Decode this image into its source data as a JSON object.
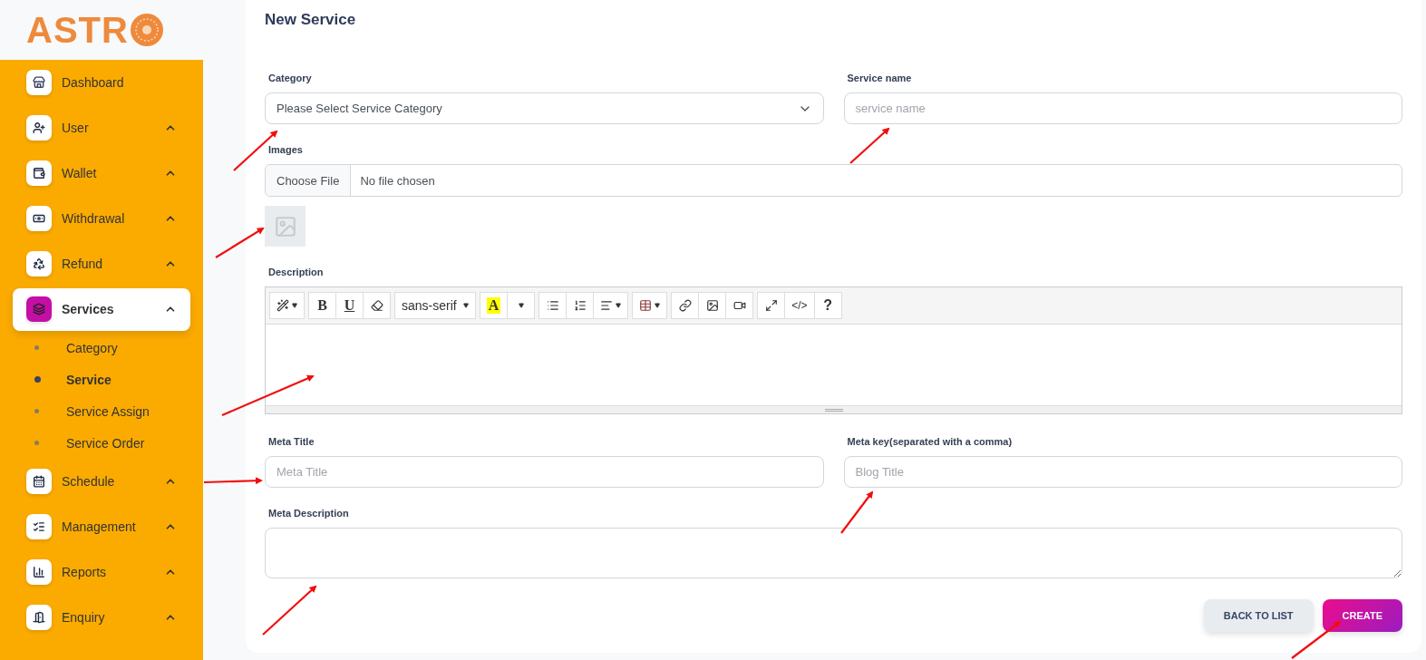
{
  "logo": {
    "text": "ASTR"
  },
  "sidebar": {
    "items": [
      {
        "label": "Dashboard",
        "kind": "store",
        "group": false,
        "selected": false
      },
      {
        "label": "User",
        "kind": "user",
        "group": true,
        "selected": false
      },
      {
        "label": "Wallet",
        "kind": "wallet",
        "group": true,
        "selected": false
      },
      {
        "label": "Withdrawal",
        "kind": "cash",
        "group": true,
        "selected": false
      },
      {
        "label": "Refund",
        "kind": "recycle",
        "group": true,
        "selected": false
      },
      {
        "label": "Services",
        "kind": "services",
        "group": true,
        "selected": true,
        "children": [
          {
            "label": "Category",
            "selected": false
          },
          {
            "label": "Service",
            "selected": true
          },
          {
            "label": "Service Assign",
            "selected": false
          },
          {
            "label": "Service Order",
            "selected": false
          }
        ]
      },
      {
        "label": "Schedule",
        "kind": "calendar",
        "group": true,
        "selected": false
      },
      {
        "label": "Management",
        "kind": "checklist",
        "group": true,
        "selected": false
      },
      {
        "label": "Reports",
        "kind": "chart",
        "group": true,
        "selected": false
      },
      {
        "label": "Enquiry",
        "kind": "enquiry",
        "group": true,
        "selected": false
      }
    ]
  },
  "form": {
    "title": "New Service",
    "category": {
      "label": "Category",
      "value": "Please Select Service Category"
    },
    "service_name": {
      "label": "Service name",
      "placeholder": "service name"
    },
    "images": {
      "label": "Images",
      "button": "Choose File",
      "status": "No file chosen"
    },
    "description": {
      "label": "Description",
      "toolbar": [
        [
          {
            "kind": "magic"
          }
        ],
        [
          {
            "kind": "bold",
            "label": "B"
          },
          {
            "kind": "underline",
            "label": "U"
          },
          {
            "kind": "eraser"
          }
        ],
        [
          {
            "kind": "font",
            "label": "sans-serif"
          }
        ],
        [
          {
            "kind": "color",
            "label": "A"
          },
          {
            "kind": "caret"
          }
        ],
        [
          {
            "kind": "ul"
          },
          {
            "kind": "ol"
          },
          {
            "kind": "align"
          }
        ],
        [
          {
            "kind": "table"
          }
        ],
        [
          {
            "kind": "link"
          },
          {
            "kind": "image"
          },
          {
            "kind": "video"
          }
        ],
        [
          {
            "kind": "fullscreen"
          },
          {
            "kind": "code",
            "label": "</>"
          },
          {
            "kind": "help",
            "label": "?"
          }
        ]
      ]
    },
    "meta_title": {
      "label": "Meta Title",
      "placeholder": "Meta Title"
    },
    "meta_key": {
      "label": "Meta key(separated with a comma)",
      "placeholder": "Blog Title"
    },
    "meta_description": {
      "label": "Meta Description"
    },
    "buttons": [
      {
        "label": "BACK TO LIST",
        "kind": "secondary"
      },
      {
        "label": "CREATE",
        "kind": "primary"
      }
    ]
  }
}
